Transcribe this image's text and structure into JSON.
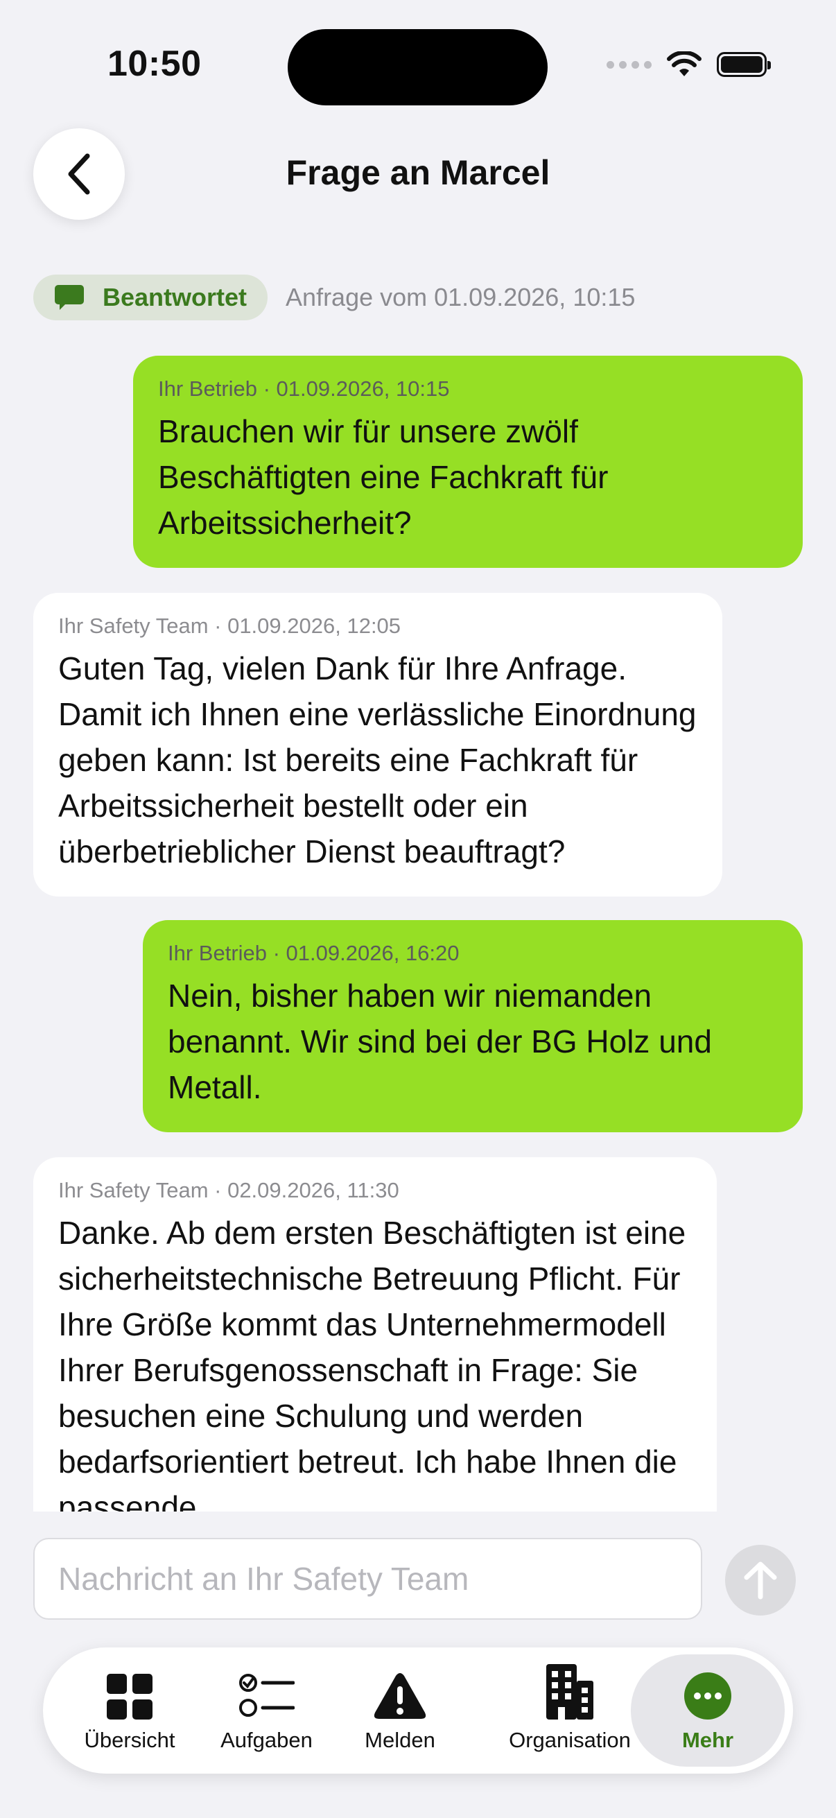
{
  "status_bar": {
    "time": "10:50"
  },
  "header": {
    "title": "Frage an Marcel"
  },
  "request": {
    "status_label": "Beantwortet",
    "date_text": "Anfrage vom 01.09.2026, 10:15"
  },
  "messages": [
    {
      "direction": "out",
      "meta": "Ihr Betrieb · 01.09.2026, 10:15",
      "text": "Brauchen wir für unsere zwölf Beschäftigten eine Fachkraft für Arbeitssicherheit?"
    },
    {
      "direction": "in",
      "meta": "Ihr Safety Team · 01.09.2026, 12:05",
      "text": "Guten Tag, vielen Dank für Ihre Anfrage. Damit ich Ihnen eine verlässliche Einordnung geben kann: Ist bereits eine Fachkraft für Arbeitssicherheit bestellt oder ein überbetrieblicher Dienst beauftragt?"
    },
    {
      "direction": "out",
      "meta": "Ihr Betrieb · 01.09.2026, 16:20",
      "text": "Nein, bisher haben wir niemanden benannt. Wir sind bei der BG Holz und Metall."
    },
    {
      "direction": "in",
      "meta": "Ihr Safety Team · 02.09.2026, 11:30",
      "text": "Danke. Ab dem ersten Beschäftigten ist eine sicherheitstechnische Betreuung Pflicht. Für Ihre Größe kommt das Unternehmermodell Ihrer Berufsgenossenschaft in Frage: Sie besuchen eine Schulung und werden bedarfsorientiert betreut. Ich habe Ihnen die passende"
    }
  ],
  "composer": {
    "placeholder": "Nachricht an Ihr Safety Team"
  },
  "tabs": [
    {
      "label": "Übersicht",
      "icon": "grid-icon"
    },
    {
      "label": "Aufgaben",
      "icon": "checklist-icon"
    },
    {
      "label": "Melden",
      "icon": "warning-icon"
    },
    {
      "label": "Organisation",
      "icon": "building-icon"
    },
    {
      "label": "Mehr",
      "icon": "more-icon",
      "active": true
    }
  ],
  "colors": {
    "accent": "#3a7d17",
    "outgoing_bubble": "#96df25",
    "incoming_bubble": "#ffffff",
    "background": "#f2f2f6"
  }
}
